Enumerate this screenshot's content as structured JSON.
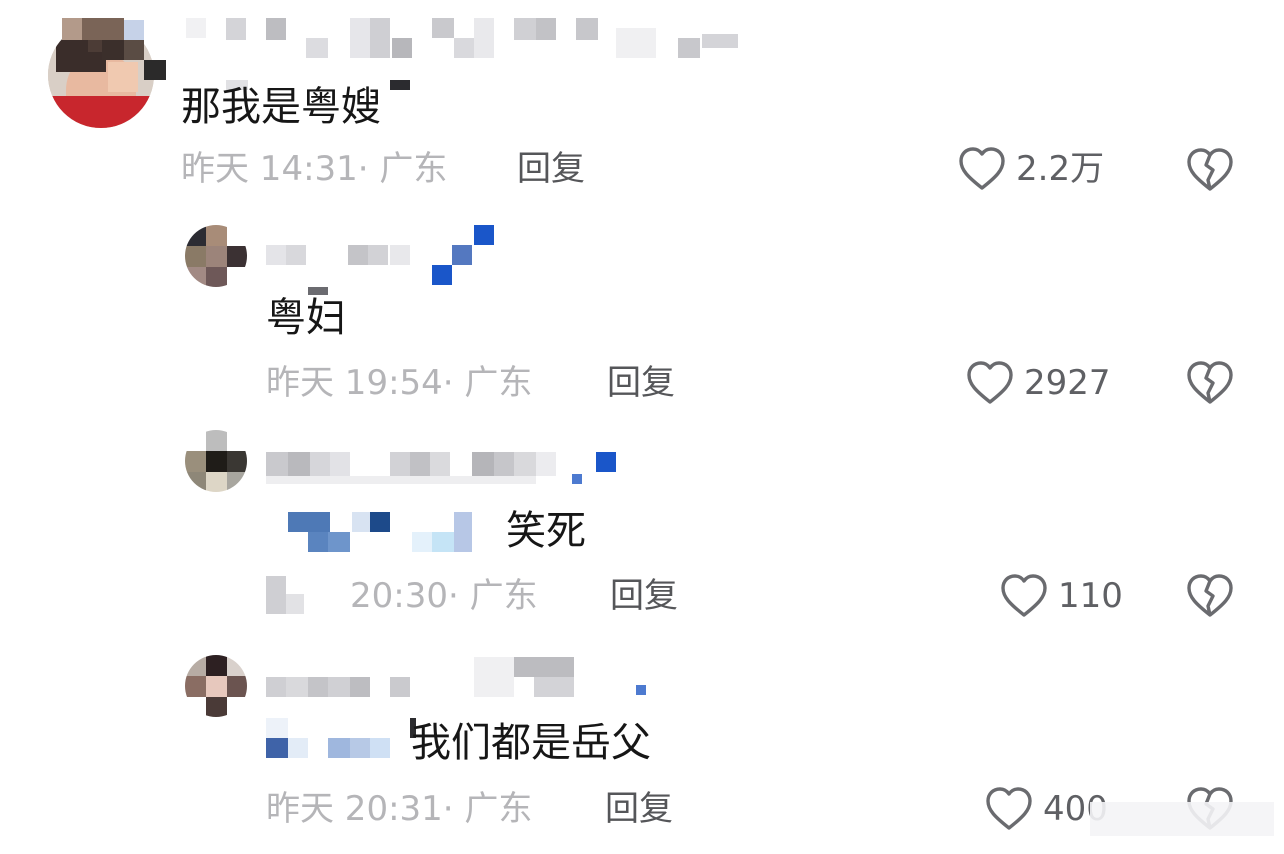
{
  "comments": [
    {
      "content": "那我是粤嫂",
      "meta": "昨天 14:31· 广东",
      "reply": "回复",
      "likes": "2.2万"
    },
    {
      "content": "粤妇",
      "meta": "昨天 19:54· 广东",
      "reply": "回复",
      "likes": "2927"
    },
    {
      "content": "笑死",
      "meta": "20:30· 广东",
      "reply": "回复",
      "likes": "110"
    },
    {
      "content": "我们都是岳父",
      "meta": "昨天 20:31· 广东",
      "reply": "回复",
      "likes": "400"
    }
  ],
  "icons": {
    "like": "heart-outline-icon",
    "dislike": "broken-heart-icon"
  },
  "colors": {
    "text": "#161616",
    "meta": "#b5b5b8",
    "action": "#555659",
    "icon": "#6a6b6f",
    "badge_blue": "#1a56c9"
  }
}
